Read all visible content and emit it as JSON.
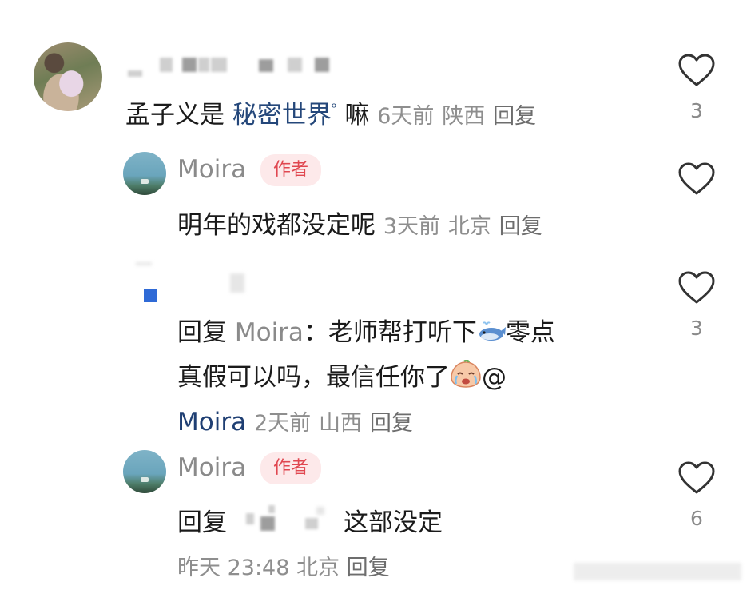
{
  "comments": [
    {
      "text_prefix": "孟子义是",
      "link": "秘密世界",
      "text_suffix": "嘛",
      "time": "6天前",
      "location": "陕西",
      "reply": "回复",
      "likes": "3"
    },
    {
      "username": "Moira",
      "badge": "作者",
      "text": "明年的戏都没定呢",
      "time": "3天前",
      "location": "北京",
      "reply": "回复",
      "likes": ""
    },
    {
      "reply_label": "回复",
      "reply_to": "Moira",
      "line1": "：老师帮打听下",
      "line1_after": "零点",
      "line2": "真假可以吗，最信任你了",
      "at_symbol": "@",
      "mention": "Moira",
      "time": "2天前",
      "location": "山西",
      "reply": "回复",
      "likes": "3"
    },
    {
      "username": "Moira",
      "badge": "作者",
      "reply_label": "回复",
      "text": "这部没定",
      "time": "昨天 23:48",
      "location": "北京",
      "reply": "回复",
      "likes": "6"
    }
  ],
  "icons": [
    "heart-outline-icon",
    "whale-emoji-icon",
    "crying-emoji-icon"
  ],
  "colors": {
    "link": "#24477a",
    "badge_text": "#e04750",
    "badge_bg": "#fde9ea",
    "meta": "#8e8e8e"
  }
}
